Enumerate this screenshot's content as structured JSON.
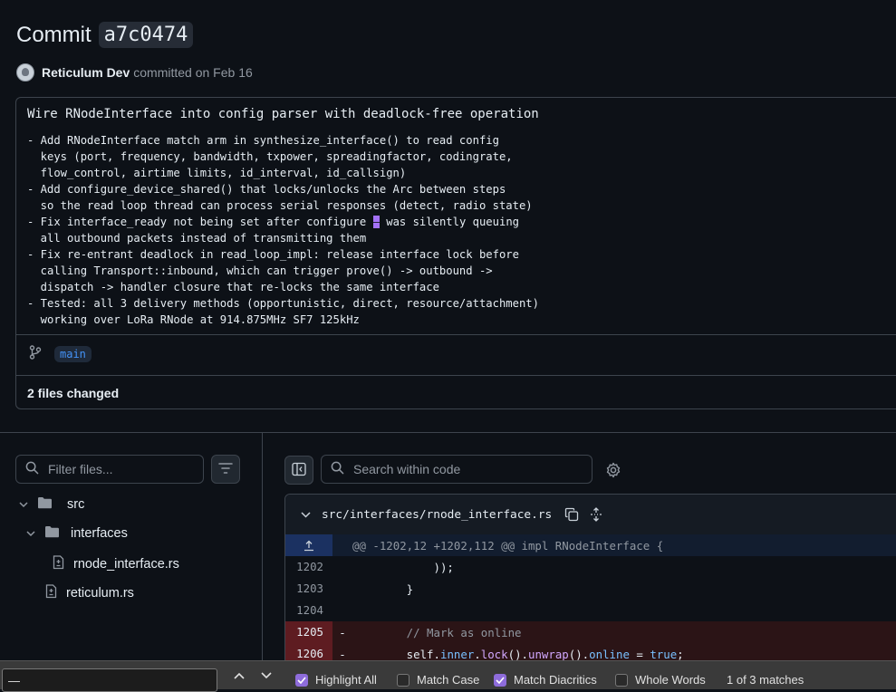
{
  "commit": {
    "title_prefix": "Commit",
    "sha": "a7c0474",
    "author": "Reticulum Dev",
    "committed_text": "committed on Feb 16",
    "message_title": "Wire RNodeInterface into config parser with deadlock-free operation",
    "body_lines": [
      "- Add RNodeInterface match arm in synthesize_interface() to read config",
      "  keys (port, frequency, bandwidth, txpower, spreadingfactor, codingrate,",
      "  flow_control, airtime limits, id_interval, id_callsign)",
      "- Add configure_device_shared() that locks/unlocks the Arc between steps",
      "  so the read loop thread can process serial responses (detect, radio state)",
      "- Fix interface_ready not being set after configure ",
      "  all outbound packets instead of transmitting them",
      "- Fix re-entrant deadlock in read_loop_impl: release interface lock before",
      "  calling Transport::inbound, which can trigger prove() -> outbound ->",
      "  dispatch -> handler closure that re-locks the same interface",
      "- Tested: all 3 delivery methods (opportunistic, direct, resource/attachment)",
      "  working over LoRa RNode at 914.875MHz SF7 125kHz"
    ],
    "highlight_match": "—",
    "line6_rest": " was silently queuing",
    "branch": "main",
    "files_changed": "2 files changed"
  },
  "file_tree": {
    "filter_placeholder": "Filter files...",
    "items": [
      {
        "label": "src",
        "type": "folder"
      },
      {
        "label": "interfaces",
        "type": "folder"
      },
      {
        "label": "rnode_interface.rs",
        "type": "file"
      },
      {
        "label": "reticulum.rs",
        "type": "file"
      }
    ]
  },
  "code_view": {
    "search_placeholder": "Search within code",
    "file_path": "src/interfaces/rnode_interface.rs",
    "hunk_header": "@@ -1202,12 +1202,112 @@ impl RNodeInterface {",
    "lines": [
      {
        "num": "1202",
        "sign": "",
        "text": "            ));"
      },
      {
        "num": "1203",
        "sign": "",
        "text": "        }"
      },
      {
        "num": "1204",
        "sign": "",
        "text": ""
      },
      {
        "num": "1205",
        "sign": "-",
        "text": "        // Mark as online"
      },
      {
        "num": "1206",
        "sign": "-",
        "text": "        self.inner.lock().unwrap().online = true;"
      }
    ]
  },
  "find_bar": {
    "input_value": "—",
    "highlight_all": "Highlight All",
    "match_case": "Match Case",
    "match_diacritics": "Match Diacritics",
    "whole_words": "Whole Words",
    "match_count": "1 of 3 matches"
  },
  "colors": {
    "background": "#0d1117",
    "accent_blue": "#4493f8",
    "deleted_line": "#2b1416",
    "checkbox_on": "#8e6cdb"
  }
}
